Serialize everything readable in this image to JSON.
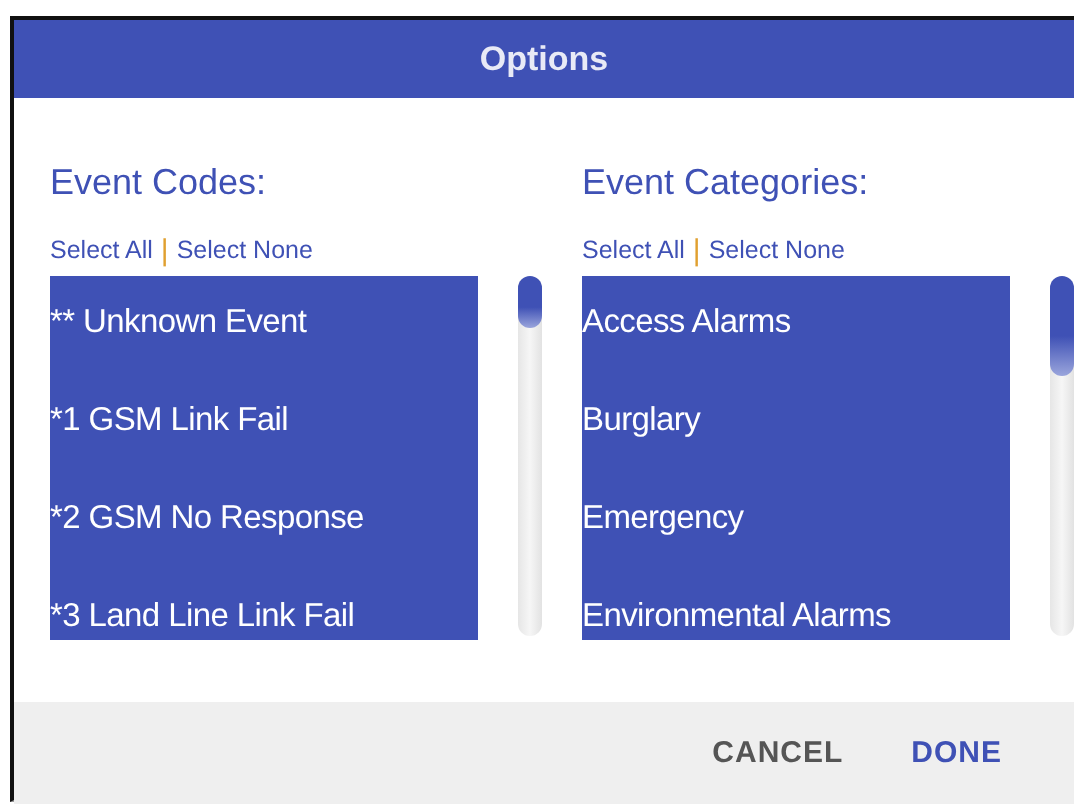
{
  "dialog": {
    "title": "Options"
  },
  "panels": [
    {
      "heading": "Event Codes:",
      "select_all": "Select All",
      "separator": "|",
      "select_none": "Select None",
      "items": [
        {
          "label": "** Unknown Event",
          "selected": true
        },
        {
          "label": "*1 GSM Link Fail",
          "selected": true
        },
        {
          "label": "*2 GSM No Response",
          "selected": true
        },
        {
          "label": "*3 Land Line Link Fail",
          "selected": true
        }
      ]
    },
    {
      "heading": "Event Categories:",
      "select_all": "Select All",
      "separator": "|",
      "select_none": "Select None",
      "items": [
        {
          "label": "Access Alarms",
          "selected": true
        },
        {
          "label": "Burglary",
          "selected": true
        },
        {
          "label": "Emergency",
          "selected": true
        },
        {
          "label": "Environmental Alarms",
          "selected": true
        }
      ]
    }
  ],
  "buttons": [
    {
      "label": "CANCEL",
      "kind": "secondary"
    },
    {
      "label": "DONE",
      "kind": "primary"
    }
  ]
}
